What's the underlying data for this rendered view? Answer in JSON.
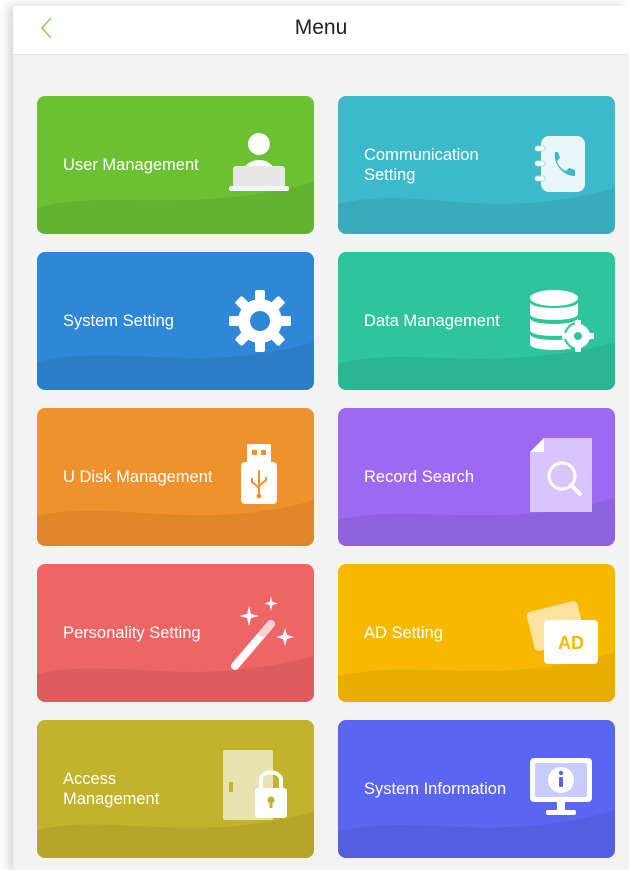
{
  "header": {
    "title": "Menu",
    "back_icon": "chevron-left-icon"
  },
  "tiles": [
    {
      "label": "User Management",
      "icon": "user-computer-icon",
      "color": "#6cc132"
    },
    {
      "label": "Communication\nSetting",
      "icon": "phone-book-icon",
      "color": "#3db9cc"
    },
    {
      "label": "System Setting",
      "icon": "gear-icon",
      "color": "#2f87d8"
    },
    {
      "label": "Data Management",
      "icon": "database-gear-icon",
      "color": "#2ec49c"
    },
    {
      "label": "U Disk Management",
      "icon": "usb-drive-icon",
      "color": "#f0922c"
    },
    {
      "label": "Record Search",
      "icon": "document-search-icon",
      "color": "#9c6af0"
    },
    {
      "label": "Personality Setting",
      "icon": "magic-wand-icon",
      "color": "#ee6566"
    },
    {
      "label": "AD Setting",
      "icon": "ad-cards-icon",
      "color": "#f8b800",
      "badge": "AD"
    },
    {
      "label": "Access\nManagement",
      "icon": "door-lock-icon",
      "color": "#c3b22c"
    },
    {
      "label": "System Information",
      "icon": "info-monitor-icon",
      "color": "#5a66f2"
    }
  ]
}
